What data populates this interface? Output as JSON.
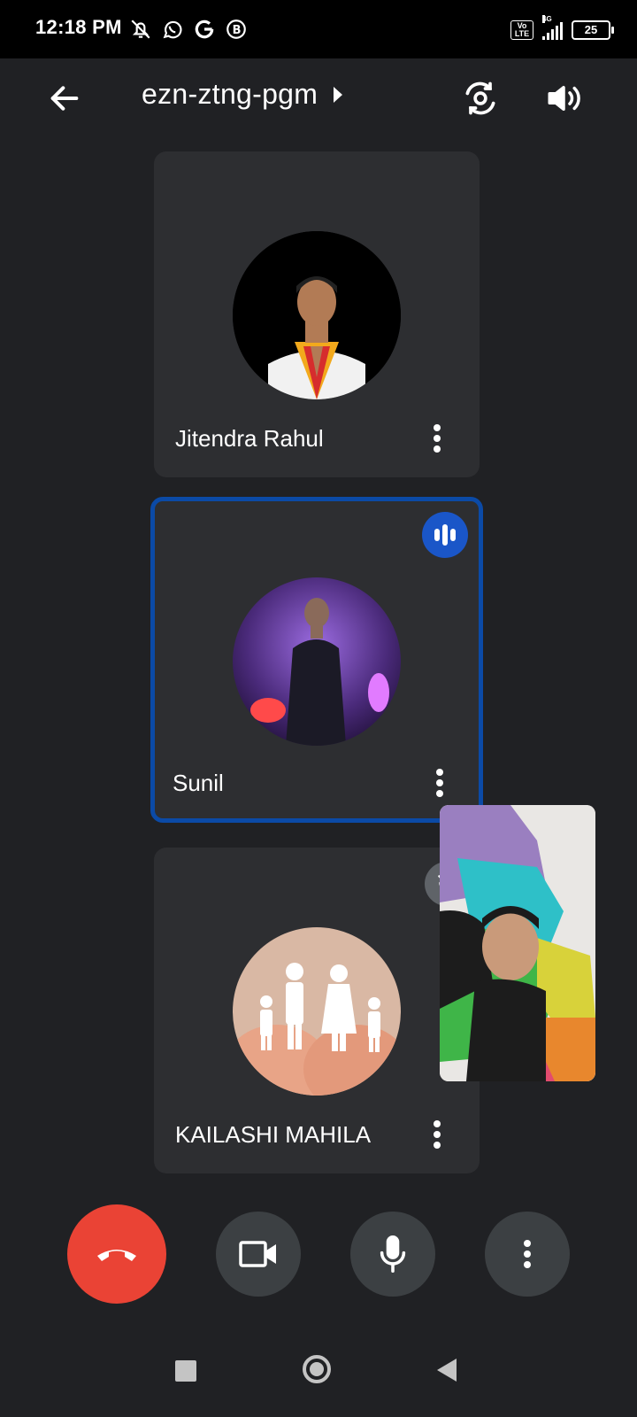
{
  "status_bar": {
    "time": "12:18 PM",
    "left_icons": [
      "bell-off-icon",
      "whatsapp-icon",
      "google-icon",
      "b-badge-icon"
    ],
    "volte": "Vo LTE",
    "network": "4G",
    "battery": "25"
  },
  "top_bar": {
    "meeting_code": "ezn-ztng-pgm",
    "icons": [
      "back-arrow-icon",
      "chevron-right-icon",
      "switch-camera-icon",
      "speaker-icon"
    ]
  },
  "participants": [
    {
      "name": "Jitendra Rahul",
      "speaking": false,
      "muted": false
    },
    {
      "name": "Sunil",
      "speaking": true,
      "muted": false
    },
    {
      "name": "KAILASHI MAHILA",
      "speaking": false,
      "muted": true
    }
  ],
  "controls": {
    "icons": [
      "end-call-icon",
      "camera-icon",
      "microphone-icon",
      "more-vert-icon"
    ]
  },
  "colors": {
    "background": "#202124",
    "tile": "#2d2e31",
    "active_border": "#0b4aa6",
    "end_call": "#ea4335",
    "control": "#3c4043"
  }
}
